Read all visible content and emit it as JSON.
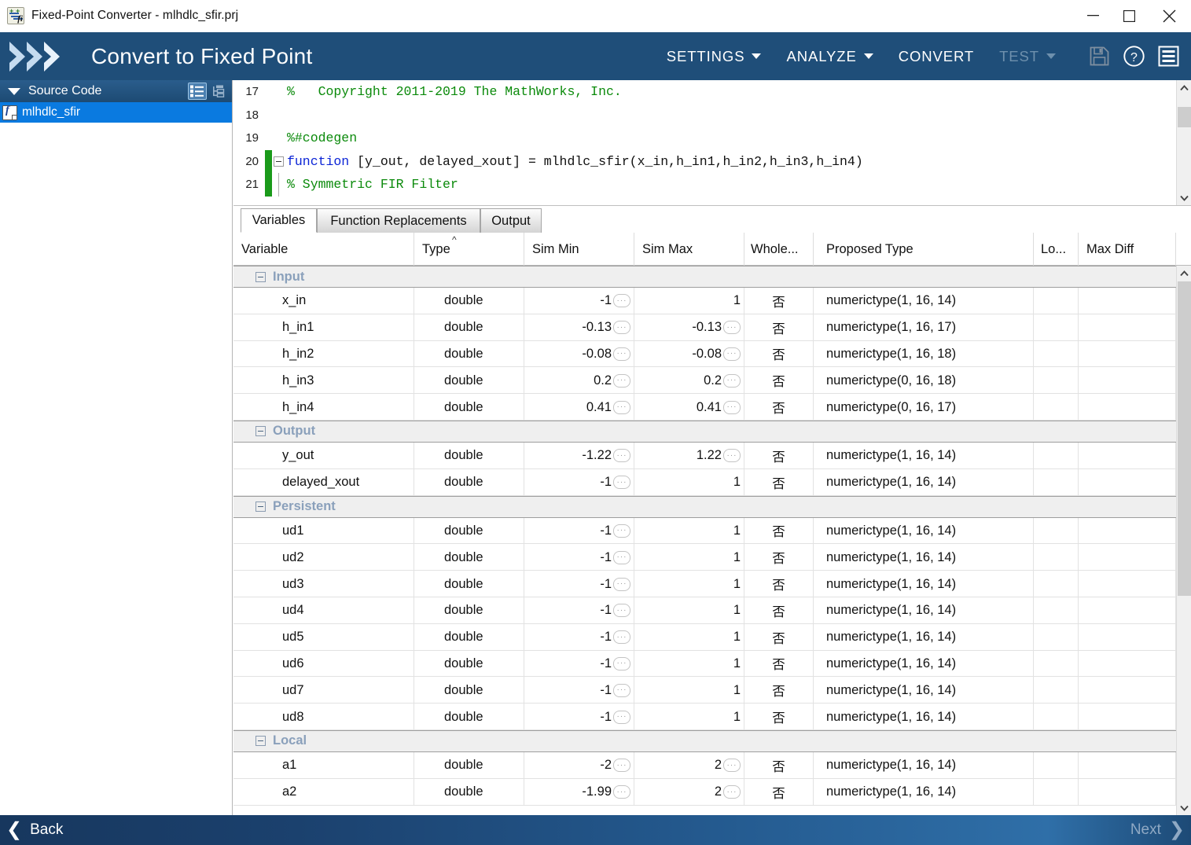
{
  "window": {
    "title": "Fixed-Point Converter - mlhdlc_sfir.prj",
    "app_icon": "fixed-point-converter-icon",
    "minimize": "—",
    "maximize": "□",
    "close": "✕"
  },
  "toolbar": {
    "app_title": "Convert to Fixed Point",
    "logo": "double-chevron-logo",
    "menus": [
      {
        "label": "SETTINGS",
        "has_caret": true,
        "disabled": false
      },
      {
        "label": "ANALYZE",
        "has_caret": true,
        "disabled": false
      },
      {
        "label": "CONVERT",
        "has_caret": false,
        "disabled": false
      },
      {
        "label": "TEST",
        "has_caret": true,
        "disabled": true
      }
    ],
    "icons": [
      {
        "name": "save-icon",
        "disabled": true
      },
      {
        "name": "help-icon",
        "disabled": false
      },
      {
        "name": "menu-icon",
        "disabled": false
      }
    ]
  },
  "sidebar": {
    "header_title": "Source Code",
    "collapse_glyph": "▼",
    "view_icons": [
      {
        "name": "list-view-icon",
        "selected": true
      },
      {
        "name": "tree-view-icon",
        "selected": false
      }
    ],
    "items": [
      {
        "label": "mlhdlc_sfir",
        "icon": "function-file-icon",
        "selected": true
      }
    ]
  },
  "editor": {
    "lines": [
      {
        "num": "17",
        "gutter": "none",
        "fold": "none",
        "tokens": [
          {
            "t": "%   Copyright 2011-2019 The MathWorks, Inc.",
            "c": "green"
          }
        ]
      },
      {
        "num": "18",
        "gutter": "none",
        "fold": "none",
        "tokens": []
      },
      {
        "num": "19",
        "gutter": "none",
        "fold": "none",
        "tokens": [
          {
            "t": "%#codegen",
            "c": "green"
          }
        ]
      },
      {
        "num": "20",
        "gutter": "green",
        "fold": "box",
        "tokens": [
          {
            "t": "function",
            "c": "blue"
          },
          {
            "t": " [y_out, delayed_xout] = mlhdlc_sfir(x_in,h_in1,h_in2,h_in3,h_in4)",
            "c": "black"
          }
        ]
      },
      {
        "num": "21",
        "gutter": "green",
        "fold": "line",
        "tokens": [
          {
            "t": "% Symmetric FIR Filter",
            "c": "green"
          }
        ]
      }
    ]
  },
  "tabs": [
    {
      "label": "Variables",
      "active": true
    },
    {
      "label": "Function Replacements",
      "active": false
    },
    {
      "label": "Output",
      "active": false
    }
  ],
  "table": {
    "columns": [
      {
        "label": "Variable",
        "sorted": false
      },
      {
        "label": "Type",
        "sorted": true,
        "sort_glyph": "^"
      },
      {
        "label": "Sim Min",
        "sorted": false
      },
      {
        "label": "Sim Max",
        "sorted": false
      },
      {
        "label": "Whole...",
        "sorted": false
      },
      {
        "label": "Proposed Type",
        "sorted": false
      },
      {
        "label": "Lo...",
        "sorted": false
      },
      {
        "label": "Max Diff",
        "sorted": false
      }
    ],
    "groups": [
      {
        "name": "Input",
        "rows": [
          {
            "variable": "x_in",
            "type": "double",
            "sim_min": "-1",
            "sim_min_btn": true,
            "sim_max": "1",
            "sim_max_btn": false,
            "whole": "否",
            "proposed": "numerictype(1, 16, 14)",
            "lo": "",
            "max_diff": ""
          },
          {
            "variable": "h_in1",
            "type": "double",
            "sim_min": "-0.13",
            "sim_min_btn": true,
            "sim_max": "-0.13",
            "sim_max_btn": true,
            "whole": "否",
            "proposed": "numerictype(1, 16, 17)",
            "lo": "",
            "max_diff": ""
          },
          {
            "variable": "h_in2",
            "type": "double",
            "sim_min": "-0.08",
            "sim_min_btn": true,
            "sim_max": "-0.08",
            "sim_max_btn": true,
            "whole": "否",
            "proposed": "numerictype(1, 16, 18)",
            "lo": "",
            "max_diff": ""
          },
          {
            "variable": "h_in3",
            "type": "double",
            "sim_min": "0.2",
            "sim_min_btn": true,
            "sim_max": "0.2",
            "sim_max_btn": true,
            "whole": "否",
            "proposed": "numerictype(0, 16, 18)",
            "lo": "",
            "max_diff": ""
          },
          {
            "variable": "h_in4",
            "type": "double",
            "sim_min": "0.41",
            "sim_min_btn": true,
            "sim_max": "0.41",
            "sim_max_btn": true,
            "whole": "否",
            "proposed": "numerictype(0, 16, 17)",
            "lo": "",
            "max_diff": ""
          }
        ]
      },
      {
        "name": "Output",
        "rows": [
          {
            "variable": "y_out",
            "type": "double",
            "sim_min": "-1.22",
            "sim_min_btn": true,
            "sim_max": "1.22",
            "sim_max_btn": true,
            "whole": "否",
            "proposed": "numerictype(1, 16, 14)",
            "lo": "",
            "max_diff": ""
          },
          {
            "variable": "delayed_xout",
            "type": "double",
            "sim_min": "-1",
            "sim_min_btn": true,
            "sim_max": "1",
            "sim_max_btn": false,
            "whole": "否",
            "proposed": "numerictype(1, 16, 14)",
            "lo": "",
            "max_diff": ""
          }
        ]
      },
      {
        "name": "Persistent",
        "rows": [
          {
            "variable": "ud1",
            "type": "double",
            "sim_min": "-1",
            "sim_min_btn": true,
            "sim_max": "1",
            "sim_max_btn": false,
            "whole": "否",
            "proposed": "numerictype(1, 16, 14)",
            "lo": "",
            "max_diff": ""
          },
          {
            "variable": "ud2",
            "type": "double",
            "sim_min": "-1",
            "sim_min_btn": true,
            "sim_max": "1",
            "sim_max_btn": false,
            "whole": "否",
            "proposed": "numerictype(1, 16, 14)",
            "lo": "",
            "max_diff": ""
          },
          {
            "variable": "ud3",
            "type": "double",
            "sim_min": "-1",
            "sim_min_btn": true,
            "sim_max": "1",
            "sim_max_btn": false,
            "whole": "否",
            "proposed": "numerictype(1, 16, 14)",
            "lo": "",
            "max_diff": ""
          },
          {
            "variable": "ud4",
            "type": "double",
            "sim_min": "-1",
            "sim_min_btn": true,
            "sim_max": "1",
            "sim_max_btn": false,
            "whole": "否",
            "proposed": "numerictype(1, 16, 14)",
            "lo": "",
            "max_diff": ""
          },
          {
            "variable": "ud5",
            "type": "double",
            "sim_min": "-1",
            "sim_min_btn": true,
            "sim_max": "1",
            "sim_max_btn": false,
            "whole": "否",
            "proposed": "numerictype(1, 16, 14)",
            "lo": "",
            "max_diff": ""
          },
          {
            "variable": "ud6",
            "type": "double",
            "sim_min": "-1",
            "sim_min_btn": true,
            "sim_max": "1",
            "sim_max_btn": false,
            "whole": "否",
            "proposed": "numerictype(1, 16, 14)",
            "lo": "",
            "max_diff": ""
          },
          {
            "variable": "ud7",
            "type": "double",
            "sim_min": "-1",
            "sim_min_btn": true,
            "sim_max": "1",
            "sim_max_btn": false,
            "whole": "否",
            "proposed": "numerictype(1, 16, 14)",
            "lo": "",
            "max_diff": ""
          },
          {
            "variable": "ud8",
            "type": "double",
            "sim_min": "-1",
            "sim_min_btn": true,
            "sim_max": "1",
            "sim_max_btn": false,
            "whole": "否",
            "proposed": "numerictype(1, 16, 14)",
            "lo": "",
            "max_diff": ""
          }
        ]
      },
      {
        "name": "Local",
        "rows": [
          {
            "variable": "a1",
            "type": "double",
            "sim_min": "-2",
            "sim_min_btn": true,
            "sim_max": "2",
            "sim_max_btn": true,
            "whole": "否",
            "proposed": "numerictype(1, 16, 14)",
            "lo": "",
            "max_diff": ""
          },
          {
            "variable": "a2",
            "type": "double",
            "sim_min": "-1.99",
            "sim_min_btn": true,
            "sim_max": "2",
            "sim_max_btn": true,
            "whole": "否",
            "proposed": "numerictype(1, 16, 14)",
            "lo": "",
            "max_diff": ""
          }
        ]
      }
    ]
  },
  "footer": {
    "back_label": "Back",
    "back_glyph": "❮",
    "next_label": "Next",
    "next_glyph": "❯",
    "next_disabled": true
  },
  "colors": {
    "brand_blue": "#1f4e79",
    "selection_blue": "#0a7ae0",
    "group_label": "#8aa0bb",
    "code_comment": "#0b8a0b",
    "code_keyword": "#0b24d6"
  }
}
